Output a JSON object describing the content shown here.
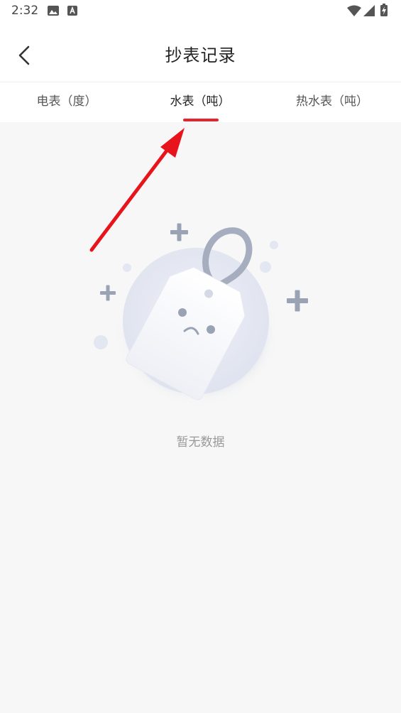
{
  "status_bar": {
    "time": "2:32",
    "left_icons": [
      "image-icon",
      "keyboard-a-icon"
    ],
    "right_icons": [
      "wifi-icon",
      "cell-signal-icon",
      "battery-charging-icon"
    ]
  },
  "header": {
    "back_icon": "chevron-left-icon",
    "title": "抄表记录"
  },
  "tabs": [
    {
      "label": "电表（度）",
      "active": false
    },
    {
      "label": "水表（吨）",
      "active": true
    },
    {
      "label": "热水表（吨）",
      "active": false
    }
  ],
  "empty_state": {
    "message": "暂无数据",
    "illustration": "sad-tag-icon"
  },
  "annotation": {
    "type": "arrow",
    "points_to": "tab-water-meter"
  },
  "colors": {
    "accent": "#e8232e",
    "background": "#f7f7f7",
    "surface": "#ffffff",
    "text_primary": "#222222",
    "text_secondary": "#555555",
    "text_muted": "#999999",
    "illustration_gray": "#9aa3b4"
  }
}
